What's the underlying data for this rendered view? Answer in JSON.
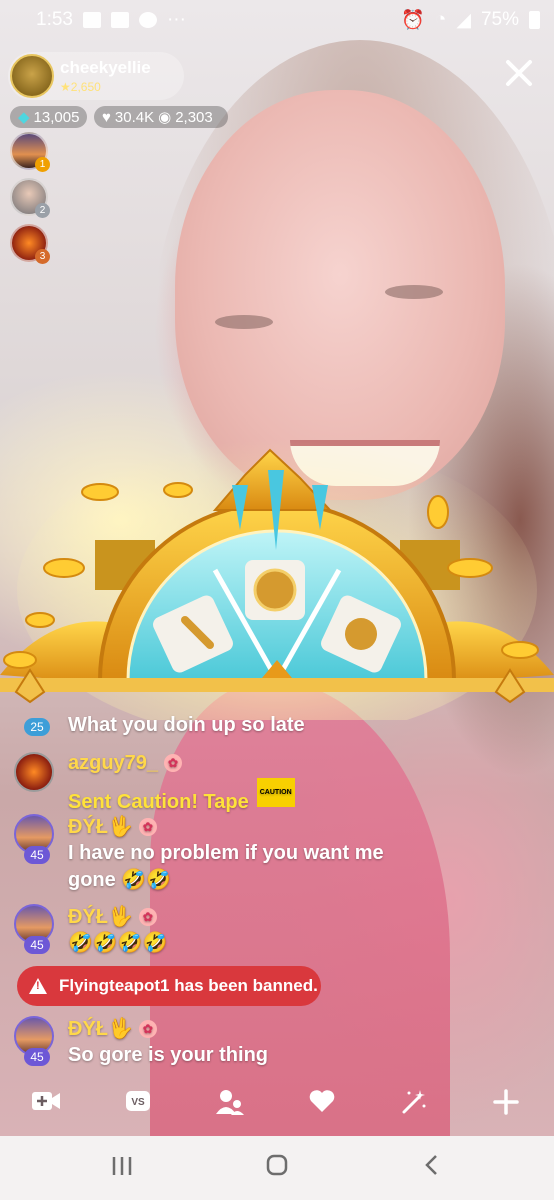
{
  "status_bar": {
    "time": "1:53",
    "notification_icons": [
      "image-icon",
      "thumb-icon",
      "add-person-icon"
    ],
    "overflow": "···",
    "battery": "75%"
  },
  "host": {
    "name": "cheekyellie",
    "level": "2,650",
    "diamonds": "13,005",
    "likes": "30.4K",
    "views": "2,303"
  },
  "top_viewers": [
    {
      "rank": "1"
    },
    {
      "rank": "2"
    },
    {
      "rank": "3"
    }
  ],
  "chat": {
    "partial_message": {
      "level": "25",
      "text": "What you doin up so late"
    },
    "messages": [
      {
        "name": "azguy79_",
        "text": "Sent Caution! Tape",
        "sticker": "CAUTION"
      },
      {
        "name": "ĐÝŁ🖖",
        "level": "45",
        "text": "I have no problem if you want me gone 🤣🤣"
      },
      {
        "name": "ĐÝŁ🖖",
        "level": "45",
        "text": "🤣🤣🤣🤣"
      },
      {
        "name": "ĐÝŁ🖖",
        "level": "45",
        "text": "So gore is your thing"
      }
    ],
    "ban_notice": "Flyingteapot1 has been banned."
  },
  "colors": {
    "name_yellow": "#ffd84a",
    "ban_red": "#d9383d",
    "level_purple": "#6d58d6"
  }
}
